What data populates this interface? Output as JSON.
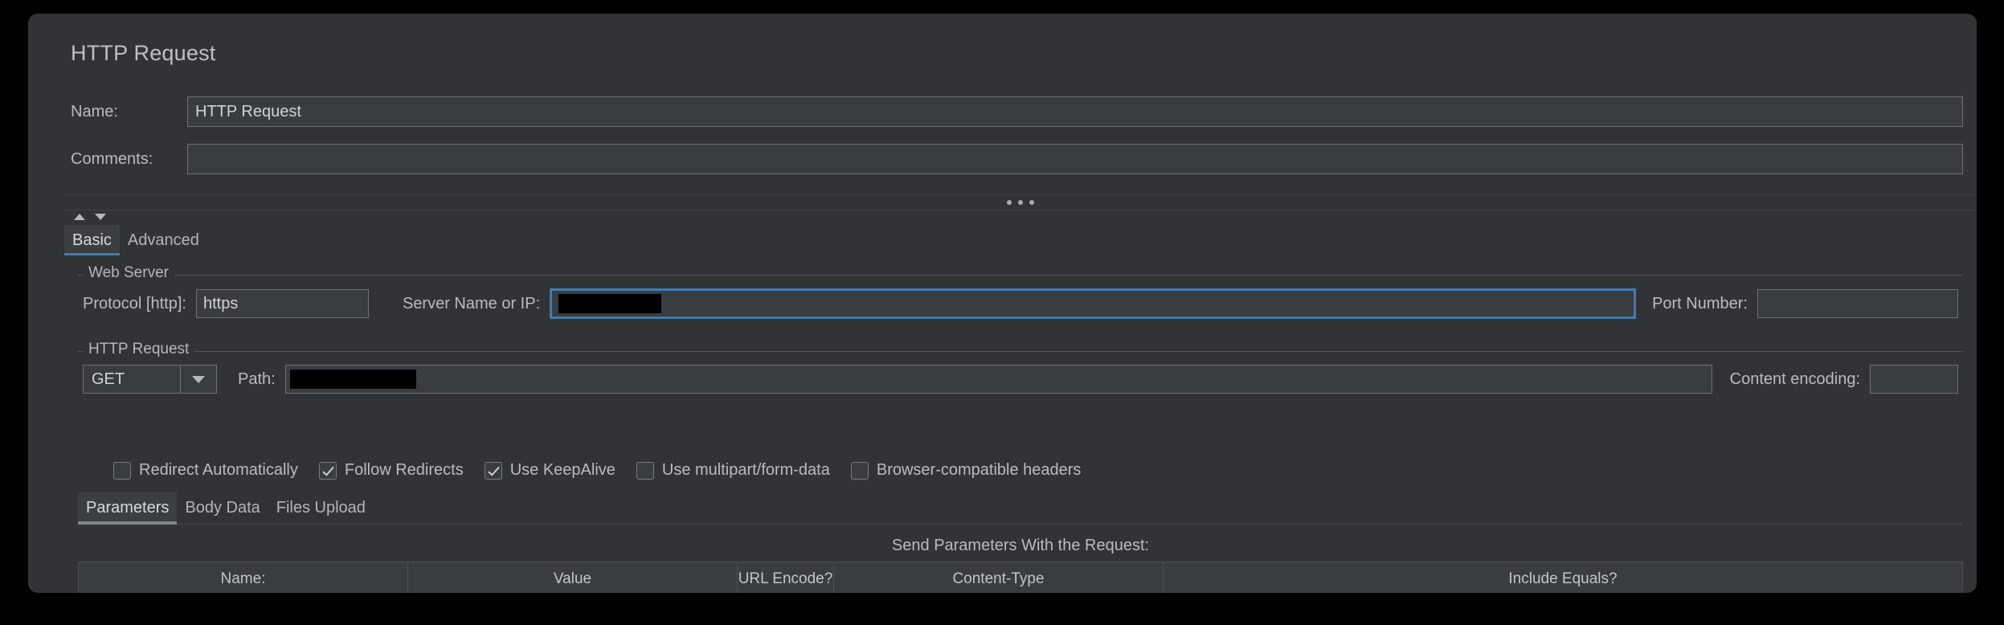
{
  "window": {
    "title": "HTTP Request",
    "background_color": "#000000",
    "panel_color": "#313336",
    "accent_color": "#3d7eb8"
  },
  "header": {
    "title": "HTTP Request",
    "fields": [
      {
        "label": "Name:",
        "value": "HTTP Request",
        "placeholder": ""
      },
      {
        "label": "Comments:",
        "value": "",
        "placeholder": ""
      }
    ]
  },
  "splitter": {
    "collapse_up_icon": "triangle-up-icon",
    "collapse_down_icon": "triangle-down-icon",
    "handle_icon": "three-dots-icon"
  },
  "main_tabs": {
    "selected": "Basic",
    "items": [
      {
        "label": "Basic",
        "selected": true
      },
      {
        "label": "Advanced",
        "selected": false
      }
    ]
  },
  "web_server": {
    "group_title": "Web Server",
    "protocol": {
      "label": "Protocol [http]:",
      "value": "https"
    },
    "server": {
      "label": "Server Name or IP:",
      "value": "",
      "redacted": true,
      "focused": true
    },
    "port": {
      "label": "Port Number:",
      "value": ""
    }
  },
  "http_request": {
    "group_title": "HTTP Request",
    "method": {
      "value": "GET",
      "arrow_icon": "chevron-down-icon"
    },
    "path": {
      "label": "Path:",
      "value": "/",
      "redacted": true
    },
    "content_encoding": {
      "label": "Content encoding:",
      "value": ""
    },
    "checkboxes": [
      {
        "label": "Redirect Automatically",
        "checked": false
      },
      {
        "label": "Follow Redirects",
        "checked": true
      },
      {
        "label": "Use KeepAlive",
        "checked": true
      },
      {
        "label": "Use multipart/form-data",
        "checked": false
      },
      {
        "label": "Browser-compatible headers",
        "checked": false
      }
    ]
  },
  "sub_tabs": {
    "selected": "Parameters",
    "items": [
      {
        "label": "Parameters",
        "selected": true
      },
      {
        "label": "Body Data",
        "selected": false
      },
      {
        "label": "Files Upload",
        "selected": false
      }
    ]
  },
  "parameters": {
    "caption": "Send Parameters With the Request:",
    "columns": [
      "Name:",
      "Value",
      "URL Encode?",
      "Content-Type",
      "Include Equals?"
    ],
    "rows": []
  }
}
